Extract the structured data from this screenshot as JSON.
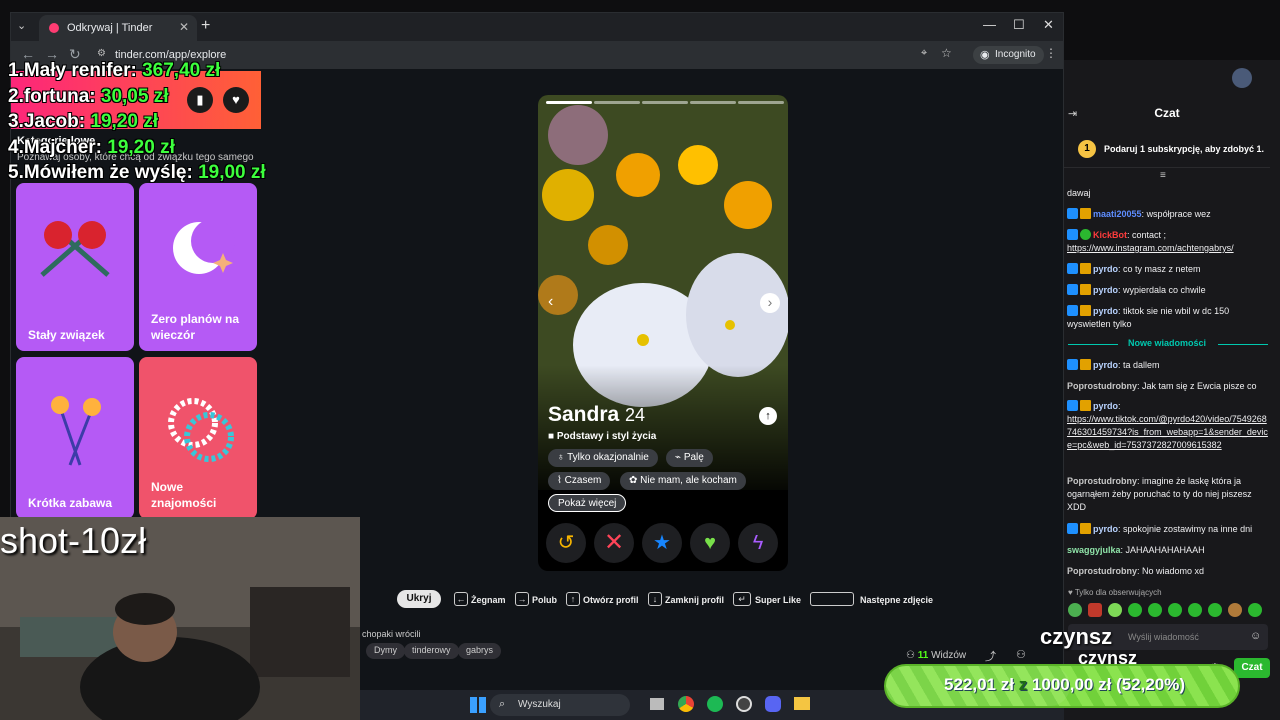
{
  "browser": {
    "tab_title": "Odkrywaj | Tinder",
    "url": "tinder.com/app/explore",
    "incognito_label": "Incognito"
  },
  "left_panel": {
    "title": "Kategorie lowe",
    "subtitle": "Poznawaj osoby, które chcą od związku tego samego",
    "cards": [
      {
        "label": "Stały związek",
        "color": "#b55af5"
      },
      {
        "label": "Zero planów na wieczór",
        "color": "#b55af5"
      },
      {
        "label": "Krótka zabawa",
        "color": "#b55af5"
      },
      {
        "label": "Nowe znajomości",
        "color": "#f0536b"
      }
    ]
  },
  "leaderboard": [
    {
      "name": "1.Mały renifer:",
      "amount": "367,40 zł"
    },
    {
      "name": "2.fortuna:",
      "amount": "30,05 zł"
    },
    {
      "name": "3.Jacob:",
      "amount": "19,20 zł"
    },
    {
      "name": "4.Majcher:",
      "amount": "19,20 zł"
    },
    {
      "name": "5.Mówiłem że wyślę:",
      "amount": "19,00 zł"
    }
  ],
  "profile": {
    "name": "Sandra",
    "age": "24",
    "info": "Podstawy i styl życia",
    "chips": [
      "Tylko okazjonalnie",
      "Palę",
      "Czasem",
      "Nie mam, ale kocham"
    ],
    "show_more": "Pokaż więcej"
  },
  "shortcuts": {
    "hide": "Ukryj",
    "items": [
      "Żegnam",
      "Polub",
      "Otwórz profil",
      "Zamknij profil",
      "Super Like",
      "Następne zdjęcie"
    ]
  },
  "stream": {
    "title_fragment": "chopaki wrócili",
    "tags": [
      "Dymy",
      "tinderowy",
      "gabrys"
    ],
    "viewers_count": "11",
    "viewers_label": "Widzów"
  },
  "taskbar": {
    "search": "Wyszukaj"
  },
  "chat": {
    "title": "Czat",
    "sub_promo": "Podaruj 1 subskrypcję, aby zdobyć 1.",
    "messages_top": [
      {
        "user": "",
        "text": "dawaj"
      },
      {
        "user": "maati20055",
        "text": "współprace wez",
        "color": "#5e8dff"
      },
      {
        "user": "KickBot",
        "text": "contact ;",
        "link": "https://www.instagram.com/achtengabrys/",
        "color": "#ff3c3c"
      },
      {
        "user": "pyrdo",
        "text": "co ty masz z netem",
        "color": "#b9d3ff"
      },
      {
        "user": "pyrdo",
        "text": "wypierdala co chwile",
        "color": "#b9d3ff"
      },
      {
        "user": "pyrdo",
        "text": "tiktok sie nie wbil w dc 150 wyswietlen tylko",
        "color": "#b9d3ff"
      }
    ],
    "new_messages": "Nowe wiadomości",
    "messages_bottom": [
      {
        "user": "pyrdo",
        "text": "ta dallem",
        "color": "#b9d3ff"
      },
      {
        "user": "Poprostudrobny",
        "text": "Jak tam się z Ewcia pisze co",
        "color": "#c7c7c7"
      },
      {
        "user": "pyrdo",
        "text": "",
        "link": "https://www.tiktok.com/@pyrdo420/video/7549268746301459734?is_from_webapp=1&sender_device=pc&web_id=7537372827009615382",
        "color": "#b9d3ff"
      },
      {
        "user": "Poprostudrobny",
        "text": "imagine że laskę która ja ogarnąłem żeby poruchać to ty do niej piszesz XDD",
        "color": "#c7c7c7"
      },
      {
        "user": "pyrdo",
        "text": "spokojnie zostawimy na inne dni",
        "color": "#b9d3ff"
      },
      {
        "user": "swaggyjulka",
        "text": "JAHAAHAHAHAAH",
        "color": "#8fe3a8"
      },
      {
        "user": "Poprostudrobny",
        "text": "No wiadomo xd",
        "color": "#c7c7c7"
      }
    ],
    "followers_only": "Tylko dla obserwujących",
    "input_placeholder": "Wyślij wiadomość",
    "send": "Czat"
  },
  "overlays": {
    "shot": "shot-10zł",
    "czynsz": "czynsz",
    "goal_current": "522,01 zł",
    "goal_sep": "z",
    "goal_target": "1000,00 zł",
    "goal_percent": "(52,20%)",
    "goal_fraction": 0.522
  }
}
